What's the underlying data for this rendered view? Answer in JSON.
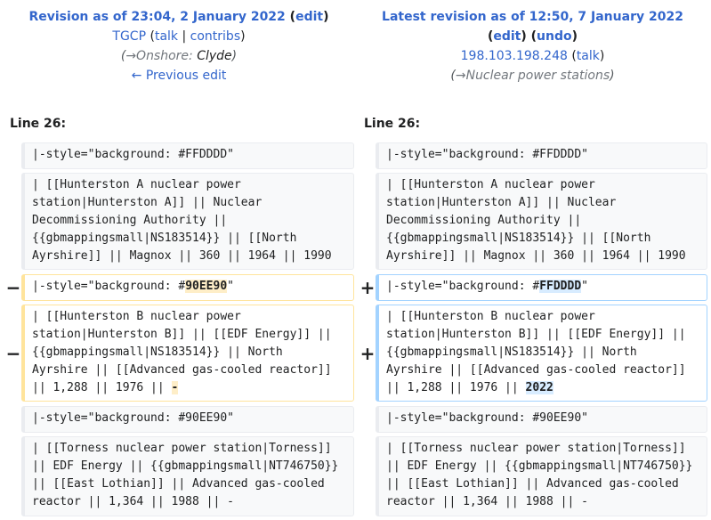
{
  "left_header": {
    "title_prefix": "Revision as of 23:04, 2 January 2022",
    "edit_label": "edit",
    "user": "TGCP",
    "talk": "talk",
    "contribs": "contribs",
    "summary_section": "→Onshore:",
    "summary_comment": "Clyde",
    "prev_edit": "← Previous edit"
  },
  "right_header": {
    "title": "Latest revision as of 12:50, 7 January 2022",
    "edit_label": "edit",
    "undo_label": "undo",
    "user": "198.103.198.248",
    "talk": "talk",
    "summary_section": "→Nuclear power stations"
  },
  "line_label": "Line 26:",
  "markers": {
    "minus": "−",
    "plus": "+"
  },
  "rows": {
    "r1": "|-style=\"background: #FFDDDD\"",
    "r2": "| [[Hunterston A nuclear power\nstation|Hunterston A]] || Nuclear\nDecommissioning Authority ||\n{{gbmappingsmall|NS183514}} || [[North\nAyrshire]] || Magnox || 360 || 1964 || 1990",
    "r3_prefix": "|-style=\"background: #",
    "r3_left_change": "90EE90",
    "r3_right_change": "FFDDDD",
    "r3_suffix": "\"",
    "r4_base": "| [[Hunterston B nuclear power\nstation|Hunterston B]] || [[EDF Energy]] ||\n{{gbmappingsmall|NS183514}} || North\nAyrshire || [[Advanced gas-cooled reactor]]\n|| 1,288 || 1976 || ",
    "r4_left_change": "-",
    "r4_right_change": "2022",
    "r5": "|-style=\"background: #90EE90\"",
    "r6": "| [[Torness nuclear power station|Torness]]\n|| EDF Energy || {{gbmappingsmall|NT746750}}\n|| [[East Lothian]] || Advanced gas-cooled\nreactor || 1,364 || 1988 || -"
  }
}
